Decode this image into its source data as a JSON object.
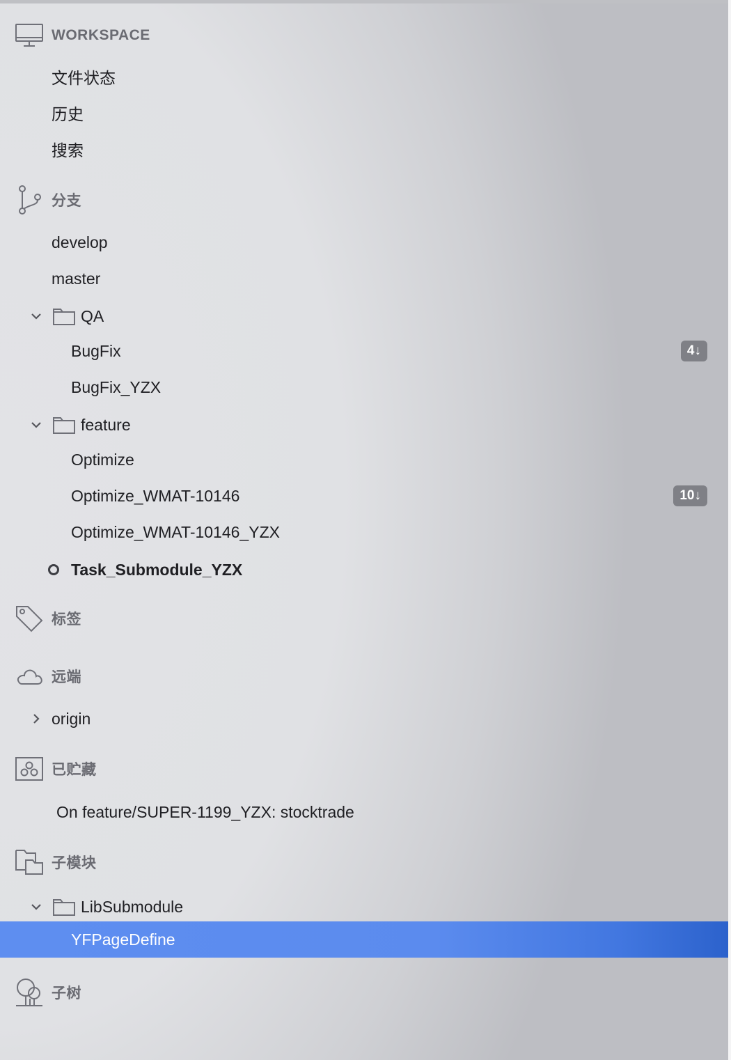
{
  "workspace": {
    "title": "WORKSPACE",
    "icon": "monitor-icon",
    "items": [
      {
        "label": "文件状态"
      },
      {
        "label": "历史"
      },
      {
        "label": "搜索"
      }
    ]
  },
  "branches": {
    "title": "分支",
    "icon": "branch-icon",
    "items": [
      {
        "label": "develop"
      },
      {
        "label": "master"
      }
    ],
    "folders": [
      {
        "label": "QA",
        "items": [
          {
            "label": "BugFix",
            "badge": "4↓"
          },
          {
            "label": "BugFix_YZX"
          }
        ]
      },
      {
        "label": "feature",
        "items": [
          {
            "label": "Optimize"
          },
          {
            "label": "Optimize_WMAT-10146",
            "badge": "10↓"
          },
          {
            "label": "Optimize_WMAT-10146_YZX"
          }
        ]
      }
    ],
    "current": {
      "label": "Task_Submodule_YZX"
    }
  },
  "tags": {
    "title": "标签",
    "icon": "tag-icon"
  },
  "remotes": {
    "title": "远端",
    "icon": "cloud-icon",
    "items": [
      {
        "label": "origin"
      }
    ]
  },
  "stashes": {
    "title": "已贮藏",
    "icon": "stash-icon",
    "items": [
      {
        "label": "On feature/SUPER-1199_YZX: stocktrade"
      }
    ]
  },
  "submodules": {
    "title": "子模块",
    "icon": "submodule-icon",
    "folders": [
      {
        "label": "LibSubmodule",
        "items": [
          {
            "label": "YFPageDefine"
          }
        ]
      }
    ]
  },
  "subtrees": {
    "title": "子树",
    "icon": "subtree-icon"
  },
  "colors": {
    "selection": "#5b8bee",
    "badge": "#7f8086",
    "section_text": "#6a6b72"
  }
}
